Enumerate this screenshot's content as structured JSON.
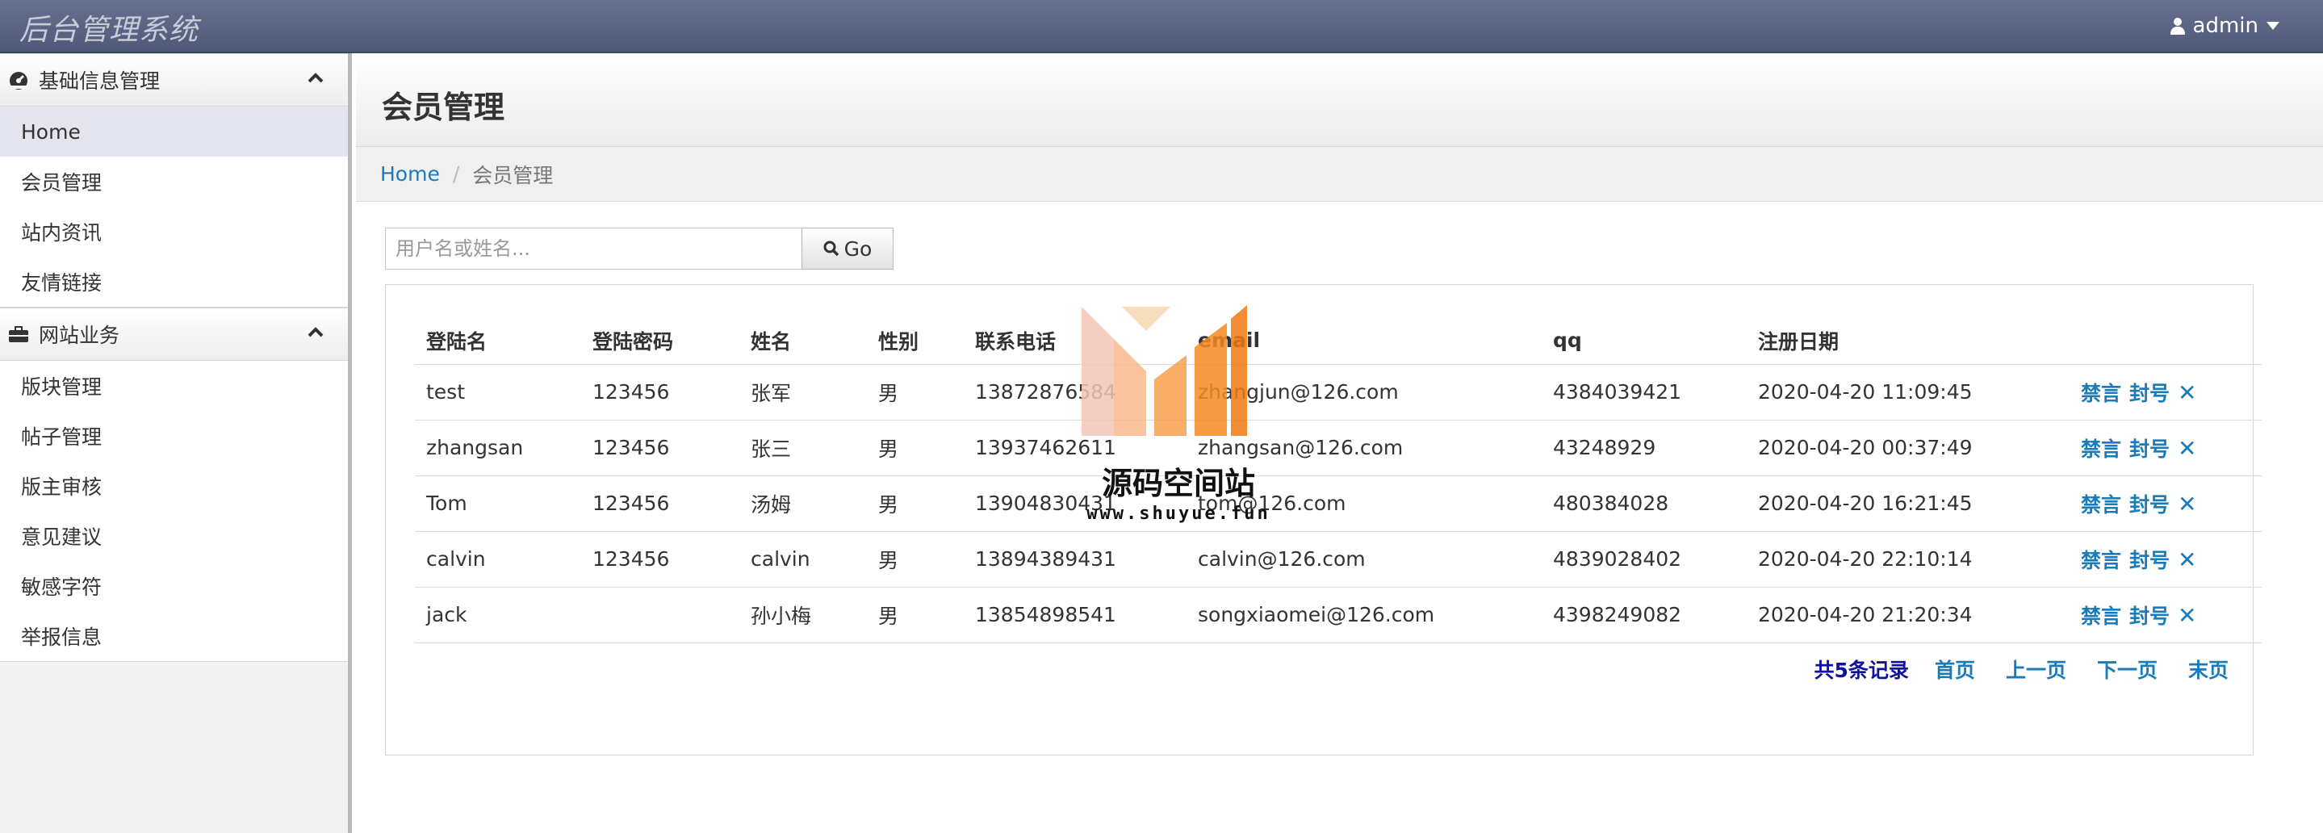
{
  "app": {
    "title": "后台管理系统"
  },
  "user": {
    "name": "admin"
  },
  "sidebar": {
    "groups": [
      {
        "title": "基础信息管理",
        "icon": "dashboard-icon",
        "items": [
          "Home",
          "会员管理",
          "站内资讯",
          "友情链接"
        ]
      },
      {
        "title": "网站业务",
        "icon": "briefcase-icon",
        "items": [
          "版块管理",
          "帖子管理",
          "版主审核",
          "意见建议",
          "敏感字符",
          "举报信息"
        ]
      }
    ],
    "active_item": "Home"
  },
  "page": {
    "title": "会员管理"
  },
  "breadcrumb": {
    "home": "Home",
    "current": "会员管理"
  },
  "search": {
    "placeholder": "用户名或姓名...",
    "button": "Go"
  },
  "table": {
    "headers": [
      "登陆名",
      "登陆密码",
      "姓名",
      "性别",
      "联系电话",
      "email",
      "qq",
      "注册日期"
    ],
    "rows": [
      [
        "test",
        "123456",
        "张军",
        "男",
        "13872876584",
        "zhangjun@126.com",
        "4384039421",
        "2020-04-20 11:09:45"
      ],
      [
        "zhangsan",
        "123456",
        "张三",
        "男",
        "13937462611",
        "zhangsan@126.com",
        "43248929",
        "2020-04-20 00:37:49"
      ],
      [
        "Tom",
        "123456",
        "汤姆",
        "男",
        "13904830431",
        "tom@126.com",
        "480384028",
        "2020-04-20 16:21:45"
      ],
      [
        "calvin",
        "123456",
        "calvin",
        "男",
        "13894389431",
        "calvin@126.com",
        "4839028402",
        "2020-04-20 22:10:14"
      ],
      [
        "jack",
        "",
        "孙小梅",
        "男",
        "13854898541",
        "songxiaomei@126.com",
        "4398249082",
        "2020-04-20 21:20:34"
      ]
    ],
    "actions": {
      "mute": "禁言",
      "ban": "封号",
      "delete": "✕"
    }
  },
  "pagination": {
    "total": "共5条记录",
    "first": "首页",
    "prev": "上一页",
    "next": "下一页",
    "last": "末页"
  },
  "watermark": {
    "text": "源码空间站",
    "url": "www.shuyue.fun"
  },
  "colors": {
    "navbar": "#5a6383",
    "link": "#1a7bb9",
    "total": "#1010a0"
  }
}
